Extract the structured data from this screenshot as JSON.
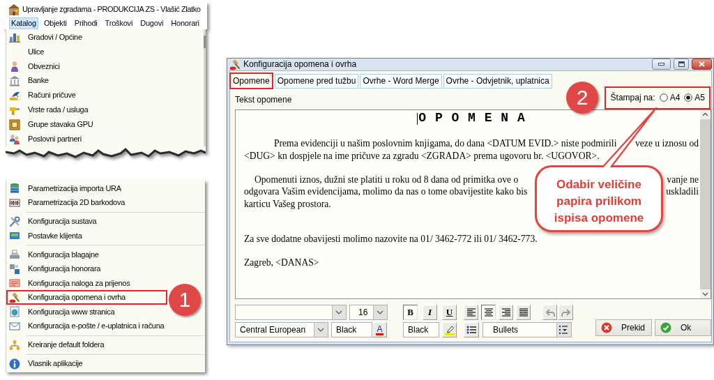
{
  "app_window": {
    "title": "Upravljanje zgradama - PRODUKCIJA ZS - Vlašić Zlatko",
    "menu_bar": [
      {
        "label": "Katalog",
        "selected": true
      },
      {
        "label": "Objekti",
        "selected": false
      },
      {
        "label": "Prihodi",
        "selected": false
      },
      {
        "label": "Troškovi",
        "selected": false
      },
      {
        "label": "Dugovi",
        "selected": false
      },
      {
        "label": "Honorari",
        "selected": false
      }
    ],
    "menu_upper": [
      {
        "label": "Gradovi / Općine"
      },
      {
        "label": "Ulice"
      },
      {
        "label": "Obveznici"
      },
      {
        "label": "Banke"
      },
      {
        "label": "Računi pričuve"
      },
      {
        "label": "Vrste rada / usluga"
      },
      {
        "label": "Grupe stavaka GPU"
      },
      {
        "label": "Poslovni partneri"
      }
    ],
    "menu_lower": [
      {
        "kind": "item",
        "label": "Parametrizacija importa URA",
        "highlighted": false
      },
      {
        "kind": "item",
        "label": "Parametrizacija 2D barkodova",
        "highlighted": false
      },
      {
        "kind": "separator"
      },
      {
        "kind": "item",
        "label": "Konfiguracija sustava",
        "highlighted": false
      },
      {
        "kind": "item",
        "label": "Postavke klijenta",
        "highlighted": false
      },
      {
        "kind": "separator"
      },
      {
        "kind": "item",
        "label": "Konfiguracija blagajne",
        "highlighted": false
      },
      {
        "kind": "item",
        "label": "Konfiguracija honorara",
        "highlighted": false
      },
      {
        "kind": "item",
        "label": "Konfiguracija naloga za prijenos",
        "highlighted": false
      },
      {
        "kind": "item",
        "label": "Konfiguracija opomena i ovrha",
        "highlighted": true
      },
      {
        "kind": "item",
        "label": "Konfiguracija www stranica",
        "highlighted": false
      },
      {
        "kind": "item",
        "label": "Konfiguracija e-pošte / e-uplatnica i računa",
        "highlighted": false
      },
      {
        "kind": "separator"
      },
      {
        "kind": "item",
        "label": "Kreiranje default foldera",
        "highlighted": false
      },
      {
        "kind": "separator"
      },
      {
        "kind": "item",
        "label": "Vlasnik aplikacije",
        "highlighted": false
      }
    ]
  },
  "dialog": {
    "title": "Konfiguracija opomena i ovrha",
    "tabs": [
      {
        "label": "Opomene",
        "selected": true,
        "highlighted": true
      },
      {
        "label": "Opomene pred tužbu",
        "selected": false,
        "highlighted": false
      },
      {
        "label": "Ovrhe - Word Merge",
        "selected": false,
        "highlighted": false
      },
      {
        "label": "Ovrhe - Odvjetnik, uplatnica",
        "selected": false,
        "highlighted": false
      }
    ],
    "editor_label": "Tekst opomene",
    "print_size": {
      "label": "Štampaj na:",
      "highlighted": true,
      "options": [
        {
          "label": "A4",
          "selected": false
        },
        {
          "label": "A5",
          "selected": true
        }
      ]
    },
    "editor": {
      "lines": [
        {
          "kind": "heading",
          "parts": [
            "O P O M E N A"
          ],
          "caret": true
        },
        {
          "kind": "blank"
        },
        {
          "kind": "wide-indent",
          "parts": [
            "Prema evidenciji u našim poslovnim knjigama, do dana <DATUM EVID.> niste podmirili",
            "veze u iznosu od"
          ]
        },
        {
          "kind": "flush",
          "parts": [
            "<DUG> kn dospjele na ime pričuve za zgradu <ZGRADA> prema ugovoru br. <UGOVOR>."
          ]
        },
        {
          "kind": "blank"
        },
        {
          "kind": "narrow-indent",
          "parts": [
            "Opomenuti iznos, dužni ste platiti u roku od 8 dana od primitka ove o",
            "vanje ne"
          ]
        },
        {
          "kind": "flush",
          "parts": [
            "odgovara Vašim evidencijama, molimo da nas o tome obavijestite kako bis",
            "uskladili"
          ]
        },
        {
          "kind": "flush",
          "parts": [
            "karticu Vašeg prostora."
          ]
        },
        {
          "kind": "blank"
        },
        {
          "kind": "blank"
        },
        {
          "kind": "flush",
          "parts": [
            "Za sve dodatne obavijesti molimo nazovite na 01/ 3462-772 ili 01/ 3462-773."
          ]
        },
        {
          "kind": "blank"
        },
        {
          "kind": "flush",
          "parts": [
            "Zagreb, <DANAS>"
          ]
        }
      ]
    },
    "toolbar": {
      "font_size": "16",
      "charset": "Central European",
      "font_color": "Black",
      "font_color_button": "A",
      "highlight_color": "Black",
      "list_style": "Bullets",
      "format_buttons": [
        {
          "kind": "bold",
          "label": "B",
          "pressed": true
        },
        {
          "kind": "italic",
          "label": "I",
          "pressed": false
        },
        {
          "kind": "underline",
          "label": "U",
          "pressed": false
        }
      ],
      "align_buttons": [
        {
          "kind": "left",
          "pressed": false
        },
        {
          "kind": "center",
          "pressed": true
        },
        {
          "kind": "right",
          "pressed": false
        },
        {
          "kind": "justify",
          "pressed": false
        }
      ],
      "history_buttons": [
        {
          "kind": "undo",
          "disabled": true
        },
        {
          "kind": "redo",
          "disabled": true
        }
      ]
    },
    "buttons": [
      {
        "kind": "cancel",
        "label": "Prekid"
      },
      {
        "kind": "ok",
        "label": "Ok"
      }
    ]
  },
  "annotations": [
    {
      "kind": "step",
      "label": "1"
    },
    {
      "kind": "step",
      "label": "2"
    },
    {
      "kind": "callout",
      "text": "Odabir veličine papira prilikom ispisa opomene"
    }
  ]
}
